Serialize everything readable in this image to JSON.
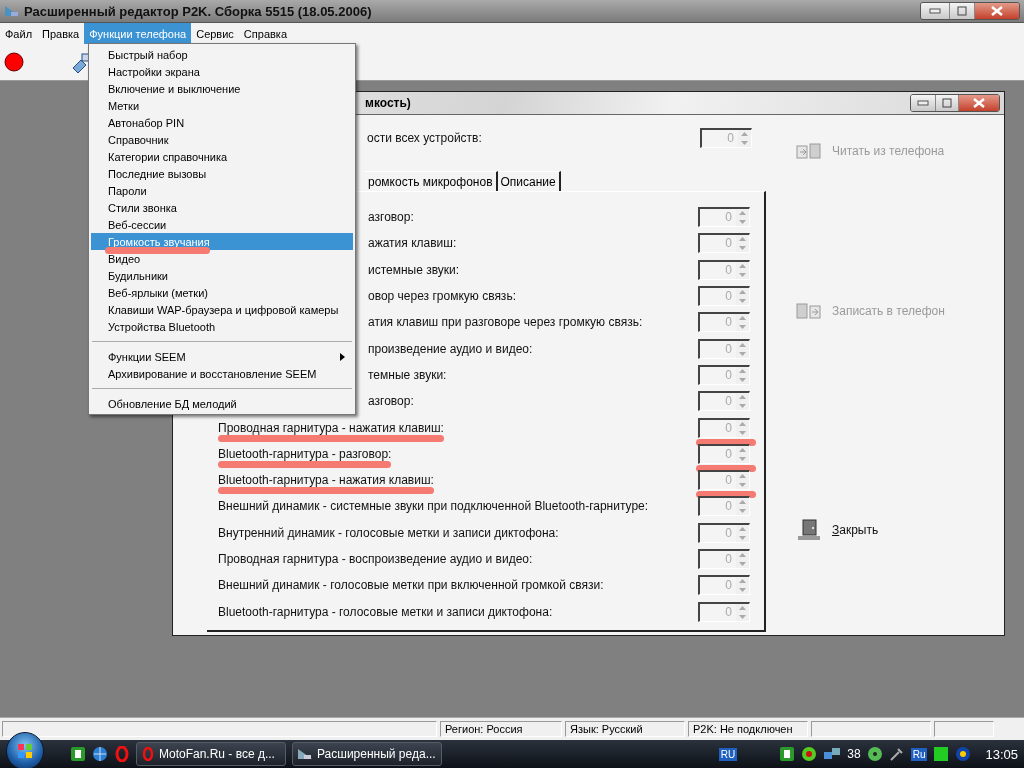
{
  "window": {
    "title": "Расширенный редактор P2K. Сборка 5515 (18.05.2006)"
  },
  "menu_bar": [
    {
      "label": "Файл",
      "selected": false
    },
    {
      "label": "Правка",
      "selected": false
    },
    {
      "label": "Функции телефона",
      "selected": true
    },
    {
      "label": "Сервис",
      "selected": false
    },
    {
      "label": "Справка",
      "selected": false
    }
  ],
  "dropdown": {
    "groups": [
      [
        {
          "label": "Быстрый набор",
          "selected": false
        },
        {
          "label": "Настройки экрана",
          "selected": false
        },
        {
          "label": "Включение и выключение",
          "selected": false
        },
        {
          "label": "Метки",
          "selected": false
        },
        {
          "label": "Автонабор PIN",
          "selected": false
        },
        {
          "label": "Справочник",
          "selected": false
        },
        {
          "label": "Категории справочника",
          "selected": false
        },
        {
          "label": "Последние вызовы",
          "selected": false
        },
        {
          "label": "Пароли",
          "selected": false
        },
        {
          "label": "Стили звонка",
          "selected": false
        },
        {
          "label": "Веб-сессии",
          "selected": false
        },
        {
          "label": "Громкость звучания",
          "selected": true,
          "marked": true
        },
        {
          "label": "Видео",
          "selected": false
        },
        {
          "label": "Будильники",
          "selected": false
        },
        {
          "label": "Веб-ярлыки (метки)",
          "selected": false
        },
        {
          "label": "Клавиши WAP-браузера и цифровой камеры",
          "selected": false
        },
        {
          "label": "Устройства Bluetooth",
          "selected": false
        }
      ],
      [
        {
          "label": "Функции SEEM",
          "selected": false,
          "submenu": true
        },
        {
          "label": "Архивирование и восстановление SEEM",
          "selected": false
        }
      ],
      [
        {
          "label": "Обновление БД мелодий",
          "selected": false
        }
      ]
    ]
  },
  "child_window": {
    "title": "мкость)",
    "all_devices": {
      "label": "ости всех устройств:",
      "value": "0",
      "disabled": true
    },
    "tabs": [
      {
        "label": "ромкость микрофонов",
        "selected": false
      },
      {
        "label": "Описание",
        "selected": false
      }
    ],
    "rows": [
      {
        "label": "азговор:",
        "value": "0",
        "partial": true,
        "disabled": true
      },
      {
        "label": "ажатия клавиш:",
        "value": "0",
        "partial": true,
        "disabled": true
      },
      {
        "label": "истемные звуки:",
        "value": "0",
        "partial": true,
        "disabled": true
      },
      {
        "label": "овор через громкую связь:",
        "value": "0",
        "partial": true,
        "disabled": true
      },
      {
        "label": "атия клавиш при разговоре через громкую связь:",
        "value": "0",
        "partial": true,
        "disabled": true
      },
      {
        "label": "произведение аудио и видео:",
        "value": "0",
        "partial": true,
        "disabled": true
      },
      {
        "label": "темные звуки:",
        "value": "0",
        "partial": true,
        "disabled": true
      },
      {
        "label": "азговор:",
        "value": "0",
        "partial": true,
        "disabled": true
      },
      {
        "label": "Проводная гарнитура - нажатия клавиш:",
        "value": "0",
        "disabled": true,
        "marked": true
      },
      {
        "label": "Bluetooth-гарнитура - разговор:",
        "value": "0",
        "disabled": true,
        "marked": true
      },
      {
        "label": "Bluetooth-гарнитура - нажатия клавиш:",
        "value": "0",
        "disabled": true,
        "marked": true
      },
      {
        "label": "Внешний динамик - системные звуки при подключенной Bluetooth-гарнитуре:",
        "value": "0",
        "disabled": true
      },
      {
        "label": "Внутренний динамик - голосовые метки и записи диктофона:",
        "value": "0",
        "disabled": true
      },
      {
        "label": "Проводная гарнитура - воспроизведение аудио и видео:",
        "value": "0",
        "disabled": true
      },
      {
        "label": "Внешний динамик - голосовые метки при включенной громкой связи:",
        "value": "0",
        "disabled": true
      },
      {
        "label": "Bluetooth-гарнитура - голосовые метки и записи диктофона:",
        "value": "0",
        "disabled": true
      }
    ],
    "actions": [
      {
        "label": "Читать из телефона",
        "kind": "read",
        "disabled": true
      },
      {
        "label": "Записать в телефон",
        "kind": "write",
        "disabled": true
      },
      {
        "label": "Закрыть",
        "kind": "close",
        "disabled": false,
        "access_key": true
      }
    ]
  },
  "status_bar": [
    "Регион: Россия",
    "Язык: Русский",
    "P2K: Не подключен"
  ],
  "taskbar": {
    "tasks": [
      {
        "label": "MotoFan.Ru - все д...",
        "kind": "browser"
      },
      {
        "label": "Расширенный реда...",
        "kind": "app"
      }
    ],
    "tray": {
      "indicator": "RU",
      "count": "38",
      "language": "Ru",
      "clock": "13:05"
    }
  }
}
